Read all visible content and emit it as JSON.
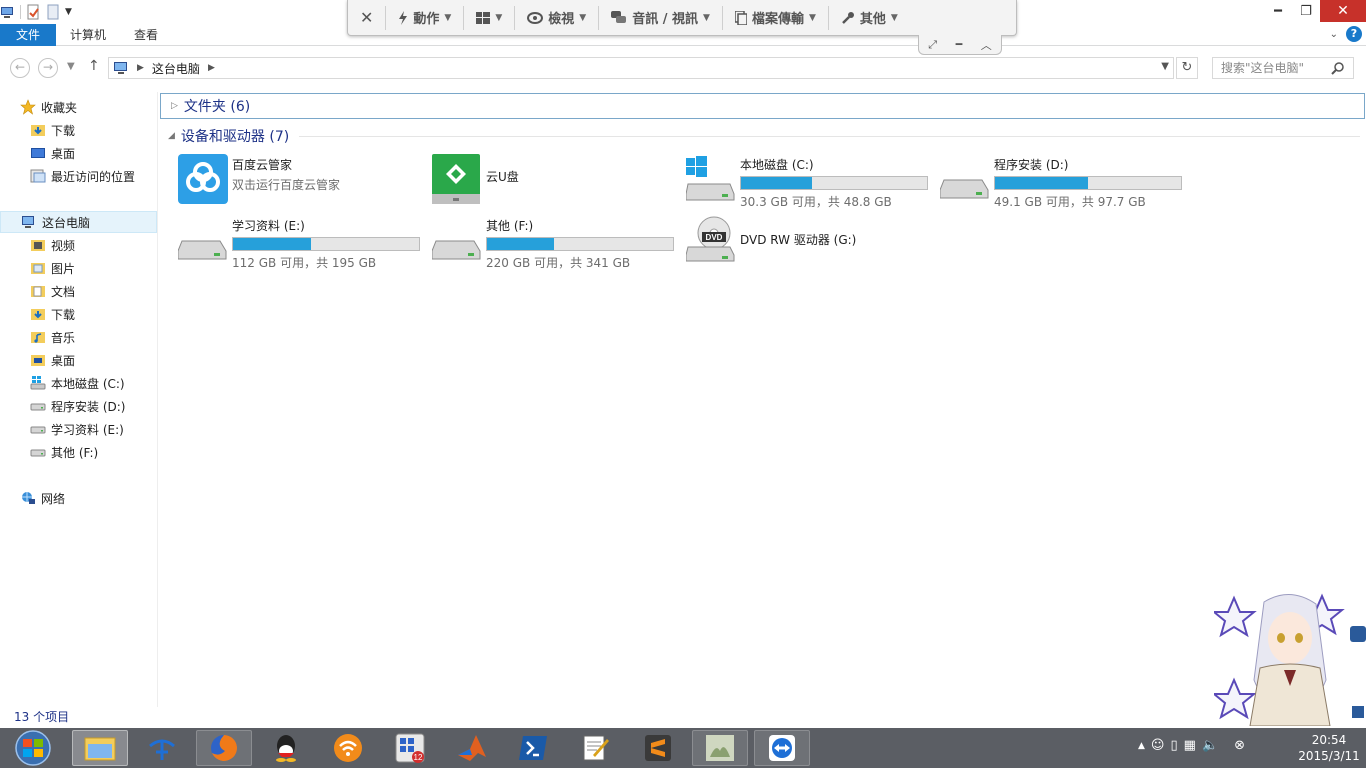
{
  "ribbon": {
    "tabs": [
      "文件",
      "计算机",
      "查看"
    ]
  },
  "remote_toolbar": {
    "close_label": "✕",
    "items": [
      {
        "label": "動作",
        "icon": "bolt-icon"
      },
      {
        "label": "",
        "icon": "windows-icon"
      },
      {
        "label": "檢視",
        "icon": "eye-icon"
      },
      {
        "label": "音訊 / 視訊",
        "icon": "chat-bubble-icon"
      },
      {
        "label": "檔案傳輸",
        "icon": "file-transfer-icon"
      },
      {
        "label": "其他",
        "icon": "tools-icon"
      }
    ]
  },
  "address": {
    "path": "这台电脑",
    "search_placeholder": "搜索\"这台电脑\""
  },
  "nav": {
    "favorites": "收藏夹",
    "fav_items": [
      "下载",
      "桌面",
      "最近访问的位置"
    ],
    "this_pc": "这台电脑",
    "pc_items": [
      "视频",
      "图片",
      "文档",
      "下载",
      "音乐",
      "桌面",
      "本地磁盘 (C:)",
      "程序安装 (D:)",
      "学习资料 (E:)",
      "其他 (F:)"
    ],
    "network": "网络"
  },
  "groups": {
    "folders": "文件夹 (6)",
    "devices": "设备和驱动器 (7)"
  },
  "devices": [
    {
      "name": "百度云管家",
      "sub": "双击运行百度云管家",
      "icon": "baidu-cloud-icon"
    },
    {
      "name": "云U盘",
      "sub": "",
      "icon": "cloud-usb-icon"
    },
    {
      "name": "本地磁盘 (C:)",
      "sub": "30.3 GB 可用，共 48.8 GB",
      "used_fraction": 0.38,
      "icon": "system-drive-icon"
    },
    {
      "name": "程序安装 (D:)",
      "sub": "49.1 GB 可用，共 97.7 GB",
      "used_fraction": 0.5,
      "icon": "hard-drive-icon"
    },
    {
      "name": "学习资料 (E:)",
      "sub": "112 GB 可用，共 195 GB",
      "used_fraction": 0.42,
      "icon": "hard-drive-icon"
    },
    {
      "name": "其他 (F:)",
      "sub": "220 GB 可用，共 341 GB",
      "used_fraction": 0.36,
      "icon": "hard-drive-icon"
    },
    {
      "name": "DVD RW 驱动器 (G:)",
      "sub": "",
      "icon": "dvd-drive-icon"
    }
  ],
  "status": "13 个项目",
  "taskbar": {
    "apps": [
      "file-explorer-icon",
      "china-telecom-icon",
      "firefox-icon",
      "qq-icon",
      "wifi-share-icon",
      "app-grid-icon",
      "matlab-icon",
      "powershell-icon",
      "notepad-icon",
      "sublime-text-icon",
      "image-viewer-icon",
      "teamviewer-icon"
    ],
    "badge": "12",
    "time": "20:54",
    "date": "2015/3/11"
  },
  "colors": {
    "accent": "#1979ca",
    "bar_fill": "#26a0da",
    "taskbar": "#5b5e64",
    "close": "#c7312a"
  }
}
